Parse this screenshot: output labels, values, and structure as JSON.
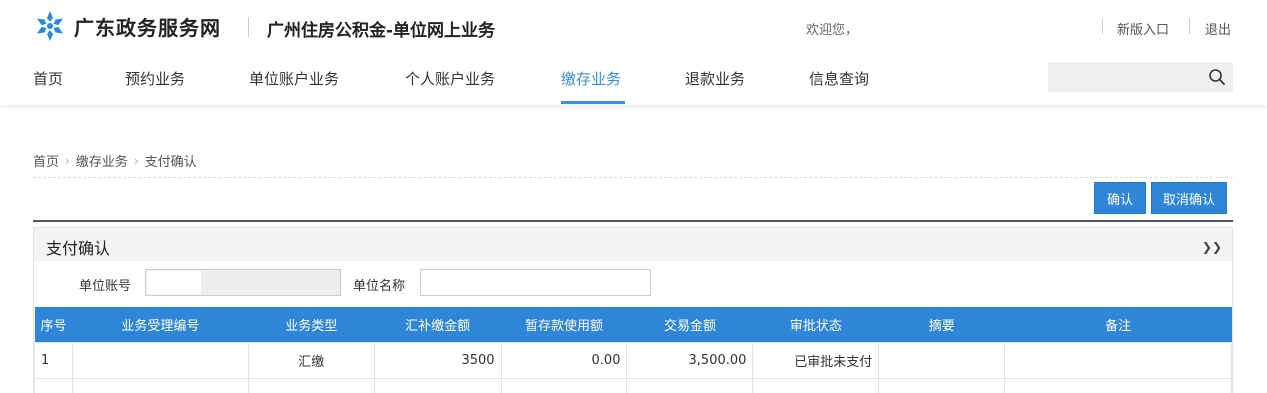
{
  "header": {
    "site_name": "广东政务服务网",
    "system_name": "广州住房公积金-单位网上业务",
    "welcome": "欢迎您，",
    "new_version": "新版入口",
    "logout": "退出"
  },
  "nav": {
    "items": [
      "首页",
      "预约业务",
      "单位账户业务",
      "个人账户业务",
      "缴存业务",
      "退款业务",
      "信息查询"
    ],
    "active": "缴存业务"
  },
  "search": {
    "value": "",
    "icon": "search-icon"
  },
  "breadcrumb": [
    "首页",
    "缴存业务",
    "支付确认"
  ],
  "actions": {
    "confirm": "确认",
    "cancel_confirm": "取消确认"
  },
  "panel": {
    "title": "支付确认",
    "collapse_icon": "double-chevron-down-icon",
    "fields": {
      "unit_account_label": "单位账号",
      "unit_account_value": "",
      "unit_name_label": "单位名称",
      "unit_name_value": ""
    }
  },
  "table": {
    "columns": [
      "序号",
      "业务受理编号",
      "业务类型",
      "汇补缴金额",
      "暂存款使用额",
      "交易金额",
      "审批状态",
      "摘要",
      "备注"
    ],
    "rows": [
      [
        "1",
        "",
        "汇缴",
        "3500",
        "0.00",
        "3,500.00",
        "已审批未支付",
        "",
        ""
      ]
    ]
  },
  "colors": {
    "accent": "#2f85d8",
    "nav_active": "#3a8fd6"
  }
}
